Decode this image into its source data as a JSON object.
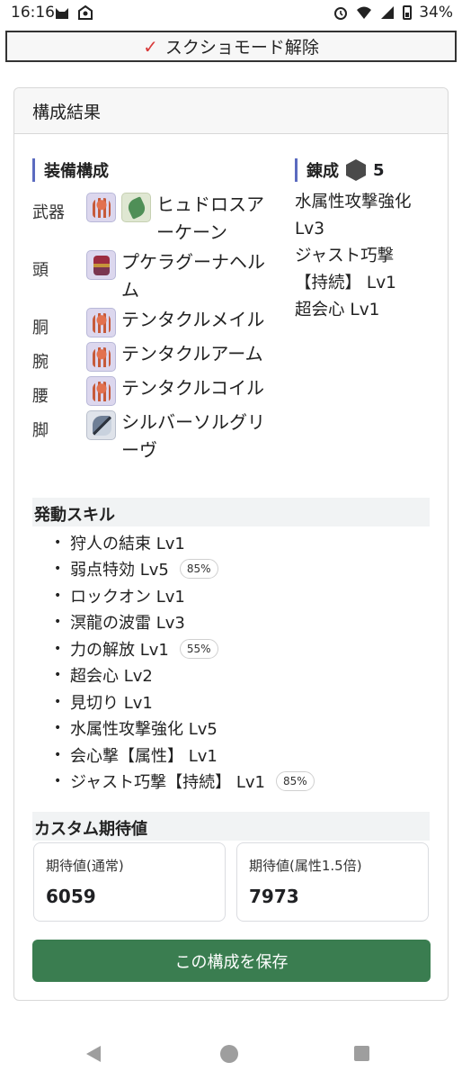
{
  "status_bar": {
    "time": "16:16",
    "battery": "34%",
    "icons": [
      "cat-icon",
      "notification-icon",
      "alarm-icon",
      "wifi-icon",
      "signal-icon",
      "battery-icon"
    ]
  },
  "mode_toggle": {
    "label": "スクショモード解除",
    "icon": "check-icon",
    "icon_color": "#d83a3a"
  },
  "card": {
    "title": "構成結果",
    "equipment": {
      "heading": "装備構成",
      "rows": [
        {
          "part": "武器",
          "name": "ヒュドロスア\nーケーン",
          "icons": [
            "octopus-icon",
            "weapon-icon"
          ]
        },
        {
          "part": "頭",
          "name": "プケラグーナヘル\nム",
          "icons": [
            "helm-icon"
          ]
        },
        {
          "part": "胴",
          "name": "テンタクルメイル",
          "icons": [
            "octopus-icon"
          ]
        },
        {
          "part": "腕",
          "name": "テンタクルアーム",
          "icons": [
            "octopus-icon"
          ]
        },
        {
          "part": "腰",
          "name": "テンタクルコイル",
          "icons": [
            "octopus-icon"
          ]
        },
        {
          "part": "脚",
          "name": "シルバーソルグリ\nーヴ",
          "icons": [
            "boots-icon"
          ]
        }
      ]
    },
    "decoration": {
      "heading": "錬成",
      "count": "5",
      "lines": [
        "水属性攻撃強化",
        "Lv3",
        "ジャスト巧撃",
        "【持続】 Lv1",
        "超会心 Lv1"
      ]
    },
    "skills": {
      "heading": "発動スキル",
      "items": [
        {
          "name": "狩人の結束 Lv1",
          "badge": ""
        },
        {
          "name": "弱点特効 Lv5",
          "badge": "85%"
        },
        {
          "name": "ロックオン Lv1",
          "badge": ""
        },
        {
          "name": "溟龍の波雷 Lv3",
          "badge": ""
        },
        {
          "name": "力の解放 Lv1",
          "badge": "55%"
        },
        {
          "name": "超会心 Lv2",
          "badge": ""
        },
        {
          "name": "見切り Lv1",
          "badge": ""
        },
        {
          "name": "水属性攻撃強化 Lv5",
          "badge": ""
        },
        {
          "name": "会心撃【属性】 Lv1",
          "badge": ""
        },
        {
          "name": "ジャスト巧撃【持続】 Lv1",
          "badge": "85%"
        }
      ]
    },
    "expected": {
      "heading": "カスタム期待値",
      "normal_label": "期待値(通常)",
      "normal_value": "6059",
      "elem_label": "期待値(属性1.5倍)",
      "elem_value": "7973"
    },
    "save_label": "この構成を保存",
    "save_color": "#3a7d50"
  }
}
